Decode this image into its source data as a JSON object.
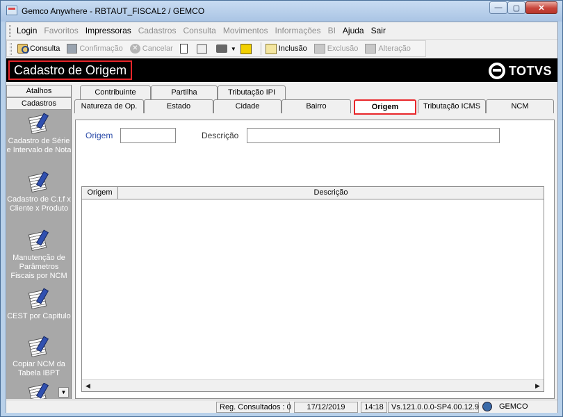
{
  "window": {
    "title": "Gemco Anywhere - RBTAUT_FISCAL2 / GEMCO",
    "minimize": "—",
    "maximize": "▢",
    "close": "✕"
  },
  "menu": {
    "items": [
      {
        "label": "Login",
        "enabled": true
      },
      {
        "label": "Favoritos",
        "enabled": false
      },
      {
        "label": "Impressoras",
        "enabled": true
      },
      {
        "label": "Cadastros",
        "enabled": false
      },
      {
        "label": "Consulta",
        "enabled": false
      },
      {
        "label": "Movimentos",
        "enabled": false
      },
      {
        "label": "Informações",
        "enabled": false
      },
      {
        "label": "BI",
        "enabled": false
      },
      {
        "label": "Ajuda",
        "enabled": true
      },
      {
        "label": "Sair",
        "enabled": true
      }
    ]
  },
  "toolbar": {
    "consulta": "Consulta",
    "confirmacao": "Confirmação",
    "cancelar": "Cancelar",
    "inclusao": "Inclusão",
    "exclusao": "Exclusão",
    "alteracao": "Alteração",
    "cancel_glyph": "✕",
    "dropdown_glyph": "▼"
  },
  "header": {
    "screen_title": "Cadastro de Origem",
    "logo": "TOTVS"
  },
  "sidebar": {
    "tab_atalhos": "Atalhos",
    "tab_cadastros": "Cadastros",
    "items": [
      {
        "label": "Cadastro de Série e Intervalo de Nota"
      },
      {
        "label": "Cadastro de C.t.f x Cliente x Produto"
      },
      {
        "label": "Manutenção de Parâmetros Fiscais por NCM"
      },
      {
        "label": "CEST por Capitulo"
      },
      {
        "label": "Copiar NCM da Tabela IBPT"
      }
    ],
    "scroll_down": "▼"
  },
  "tabs": {
    "row1": [
      "Contribuinte",
      "Partilha",
      "Tributação IPI"
    ],
    "row2": [
      "Natureza de Op.",
      "Estado",
      "Cidade",
      "Bairro",
      "Origem",
      "Tributação ICMS",
      "NCM"
    ],
    "active": "Origem"
  },
  "form": {
    "origem_label": "Origem",
    "origem_value": "",
    "descricao_label": "Descrição",
    "descricao_value": ""
  },
  "grid": {
    "columns": [
      "Origem",
      "Descrição"
    ],
    "rows": [],
    "scroll_left": "◀",
    "scroll_right": "▶"
  },
  "status": {
    "registros": "Reg. Consultados : 0",
    "date": "17/12/2019",
    "time": "14:18",
    "version": "Vs.121.0.0.0-SP4.00.12.9",
    "user": "GEMCO"
  }
}
